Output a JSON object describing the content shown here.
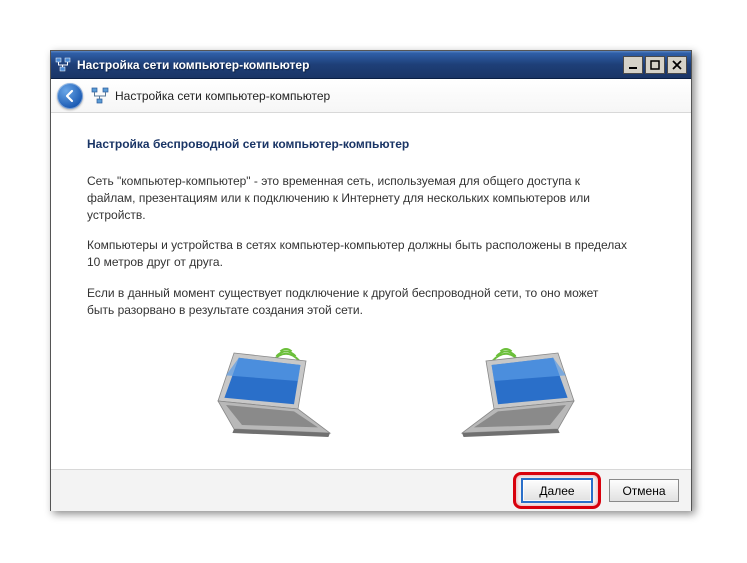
{
  "window": {
    "title": "Настройка сети компьютер-компьютер"
  },
  "header": {
    "title": "Настройка сети компьютер-компьютер"
  },
  "content": {
    "heading": "Настройка беспроводной сети компьютер-компьютер",
    "paragraph1": "Сеть \"компьютер-компьютер\" - это временная сеть, используемая для общего доступа к файлам, презентациям или к подключению к Интернету для нескольких компьютеров или устройств.",
    "paragraph2": "Компьютеры и устройства в сетях компьютер-компьютер должны быть расположены в пределах 10 метров друг от друга.",
    "paragraph3": "Если в данный момент существует подключение к другой беспроводной сети, то оно может быть разорвано в результате создания этой сети."
  },
  "footer": {
    "next_label": "Далее",
    "cancel_label": "Отмена"
  }
}
